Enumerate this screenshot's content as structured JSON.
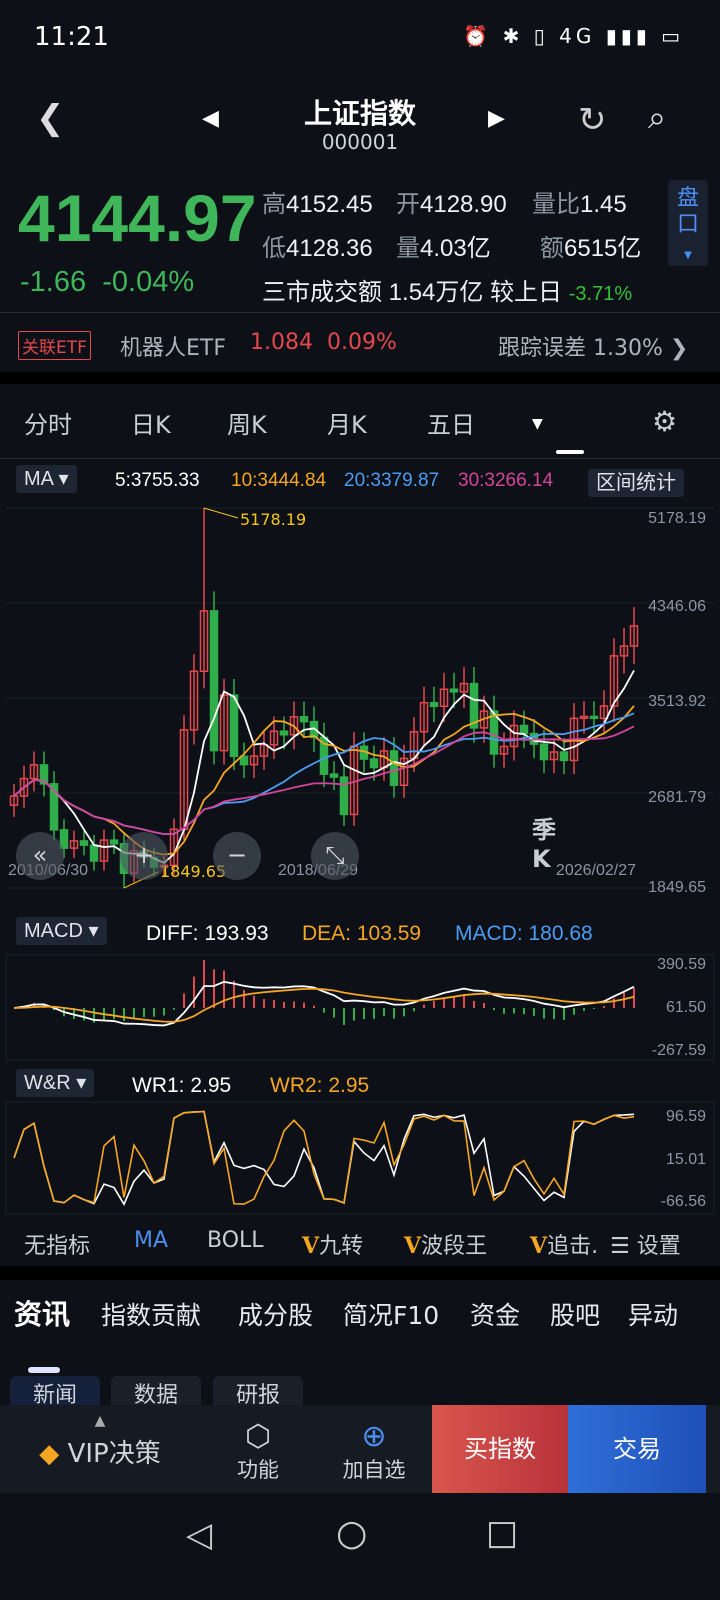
{
  "status": {
    "time": "11:21",
    "icons": "⏰ ✱ ▯ 4G ▮▮▮ ▭"
  },
  "header": {
    "title": "上证指数",
    "code": "000001"
  },
  "quote": {
    "price": "4144.97",
    "change": "-1.66",
    "change_pct": "-0.04%",
    "high_label": "高",
    "high": "4152.45",
    "open_label": "开",
    "open": "4128.90",
    "ratio_label": "量比",
    "ratio": "1.45",
    "low_label": "低",
    "low": "4128.36",
    "vol_label": "量",
    "vol": "4.03亿",
    "amt_label": "额",
    "amt": "6515亿",
    "market_label": "三市成交额",
    "market": "1.54万亿",
    "cmp_label": "较上日",
    "cmp": "-3.71%",
    "pankou": "盘口"
  },
  "etf": {
    "badge": "关联ETF",
    "name": "机器人ETF",
    "price": "1.084",
    "pct": "0.09%",
    "track_label": "跟踪误差",
    "track": "1.30%"
  },
  "period_tabs": [
    "分时",
    "日K",
    "周K",
    "月K",
    "五日",
    "季K"
  ],
  "ma_legend": {
    "selector": "MA",
    "ma5": "5:3755.33",
    "ma10": "10:3444.84",
    "ma20": "20:3379.87",
    "ma30": "30:3266.14",
    "stats": "区间统计"
  },
  "colors": {
    "up": "#e5484d",
    "down": "#2fae4a",
    "ma5": "#ffffff",
    "ma10": "#f5a623",
    "ma20": "#4a9df5",
    "ma30": "#d4449a"
  },
  "main_axis": [
    "5178.19",
    "4346.06",
    "3513.92",
    "2681.79",
    "1849.65"
  ],
  "dates": [
    "2010/06/30",
    "2018/06/29",
    "2026/02/27"
  ],
  "extremes": {
    "high": "5178.19",
    "high_index": 19,
    "low": "1849.65",
    "low_index": 11
  },
  "chart_data": {
    "type": "candlestick",
    "period": "quarter",
    "ylim": [
      1849.65,
      5178.19
    ],
    "closes": [
      2655,
      2808,
      2928,
      2762,
      2359,
      2199,
      2262,
      2225,
      2086,
      2269,
      2237,
      1979,
      2175,
      2116,
      2033,
      2048,
      2364,
      3235,
      3748,
      4277,
      3053,
      3539,
      3003,
      2930,
      3005,
      3104,
      3223,
      3192,
      3349,
      3307,
      3169,
      2847,
      2821,
      2494,
      3091,
      2979,
      2905,
      3050,
      2750,
      2985,
      3218,
      3473,
      3441,
      3591,
      3568,
      3640,
      3252,
      3399,
      3024,
      3089,
      3273,
      3202,
      3110,
      2975,
      3041,
      2967,
      3336,
      3352,
      3336,
      3444,
      3883,
      3969,
      4145
    ]
  },
  "macd": {
    "selector": "MACD",
    "diff": "DIFF: 193.93",
    "dea": "DEA: 103.59",
    "macd": "MACD: 180.68",
    "axis": [
      "390.59",
      "61.50",
      "-267.59"
    ]
  },
  "wr": {
    "selector": "W&R",
    "wr1": "WR1:  2.95",
    "wr2": "WR2:  2.95",
    "axis": [
      "96.59",
      "15.01",
      "-66.56"
    ]
  },
  "indicators": [
    "无指标",
    "MA",
    "BOLL",
    "九转",
    "波段王",
    "追击.",
    "设置"
  ],
  "news_tabs": [
    "资讯",
    "指数贡献",
    "成分股",
    "简况F10",
    "资金",
    "股吧",
    "异动"
  ],
  "sub_tabs": [
    "新闻",
    "数据",
    "研报"
  ],
  "bottom": {
    "vip": "VIP决策",
    "func": "功能",
    "add": "加自选",
    "buy": "买指数",
    "trade": "交易"
  }
}
